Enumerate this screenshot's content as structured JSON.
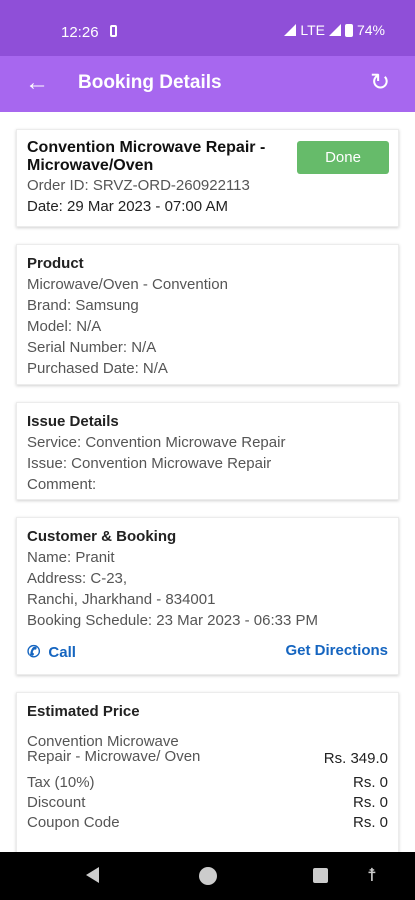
{
  "status": {
    "time": "12:26",
    "network": "LTE",
    "battery": "74%"
  },
  "app_bar": {
    "title": "Booking Details",
    "back_icon": "arrow-left-icon",
    "refresh_icon": "refresh-icon"
  },
  "booking": {
    "title": "Convention Microwave Repair - Microwave/Oven",
    "status_button": "Done",
    "order_id": "Order ID: SRVZ-ORD-260922113",
    "date": "Date: 29 Mar 2023 - 07:00 AM",
    "status_color": "#66bb6a"
  },
  "product": {
    "heading": "Product",
    "name": "Microwave/Oven - Convention",
    "brand": "Brand: Samsung",
    "model": "Model: N/A",
    "serial": "Serial Number: N/A",
    "purchased": "Purchased Date: N/A"
  },
  "issue": {
    "heading": "Issue Details",
    "service": "Service: Convention Microwave Repair",
    "issue": "Issue: Convention Microwave Repair",
    "comment": "Comment:"
  },
  "customer": {
    "heading": "Customer & Booking",
    "name": "Name: Pranit",
    "address1": "Address: C-23,",
    "address2": "Ranchi, Jharkhand - 834001",
    "schedule": "Booking Schedule: 23 Mar 2023 - 06:33 PM",
    "call_label": "Call",
    "directions_label": "Get Directions"
  },
  "price": {
    "heading": "Estimated Price",
    "items": [
      {
        "label": "Convention Microwave Repair - Microwave/ Oven",
        "amount": "Rs. 349.0"
      },
      {
        "label": "Tax (10%)",
        "amount": "Rs. 0"
      },
      {
        "label": "Discount",
        "amount": "Rs. 0"
      },
      {
        "label": "Coupon Code",
        "amount": "Rs. 0"
      }
    ]
  },
  "colors": {
    "status_bar": "#8f4fd8",
    "app_bar": "#a767ef",
    "link": "#1565c0"
  }
}
